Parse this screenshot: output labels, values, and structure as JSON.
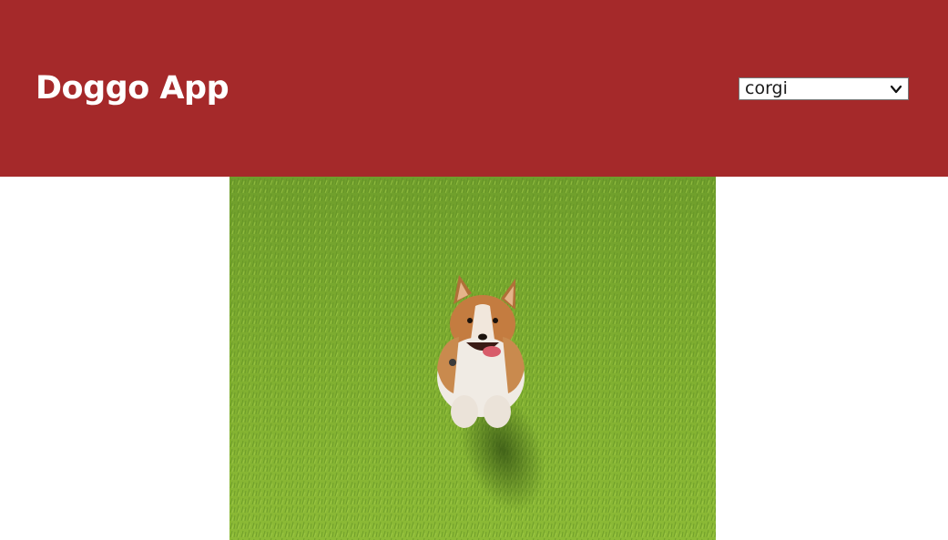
{
  "header": {
    "title": "Doggo App",
    "background_color": "#a5292a"
  },
  "breed_select": {
    "selected_value": "corgi",
    "icon": "chevron-down-icon"
  },
  "main": {
    "image_icon": "dog-photo"
  }
}
